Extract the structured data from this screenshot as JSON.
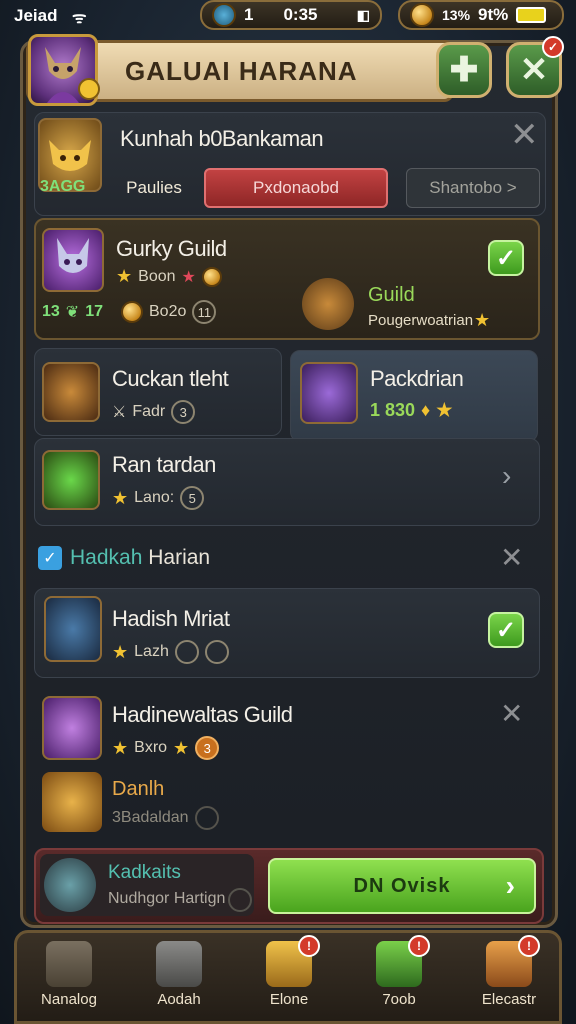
{
  "status": {
    "carrier": "Jeiad",
    "time": "0:35",
    "signal_label": "1",
    "battery_pct": "13%",
    "battery_label": "9t%"
  },
  "header": {
    "title": "GALUAI HARANA"
  },
  "profile": {
    "name": "Kunhah b0Bankaman",
    "badge_text": "3AGG",
    "tabs": [
      "Paulies",
      "Pxdonaobd",
      "Shantobo >"
    ]
  },
  "guild_card": {
    "name": "Gurky Guild",
    "row1": "Boon",
    "row2_left": "13",
    "row2_mid": "17",
    "row2_val": "Bo2o",
    "row2_badge": "11",
    "sub_title": "Guild",
    "sub_text": "Pougerwoatrian"
  },
  "left_card": {
    "name": "Cuckan tleht",
    "meta": "Fadr",
    "meta_badge": "3"
  },
  "right_card": {
    "name": "Packdrian",
    "value": "1 830"
  },
  "left_card2": {
    "name": "Ran tardan",
    "meta": "Lano:",
    "meta_badge": "5"
  },
  "section": {
    "label_a": "Hadkah",
    "label_b": "Harian"
  },
  "item1": {
    "name": "Hadish Mriat",
    "meta": "Lazh"
  },
  "item2": {
    "name": "Hadinewaltas Guild",
    "meta": "Bxro",
    "meta_badge": "3"
  },
  "item3": {
    "name": "Danlh",
    "meta": "3Badaldan"
  },
  "footer": {
    "title": "Kadkaits",
    "sub": "Nudhgor Hartign",
    "button": "DN Ovisk"
  },
  "nav": [
    "Nanalog",
    "Aodah",
    "Elone",
    "7oob",
    "Elecastr"
  ],
  "colors": {
    "accent_green": "#5fbf2c",
    "gold": "#c89a3c",
    "red_tab": "#b43a3a"
  }
}
